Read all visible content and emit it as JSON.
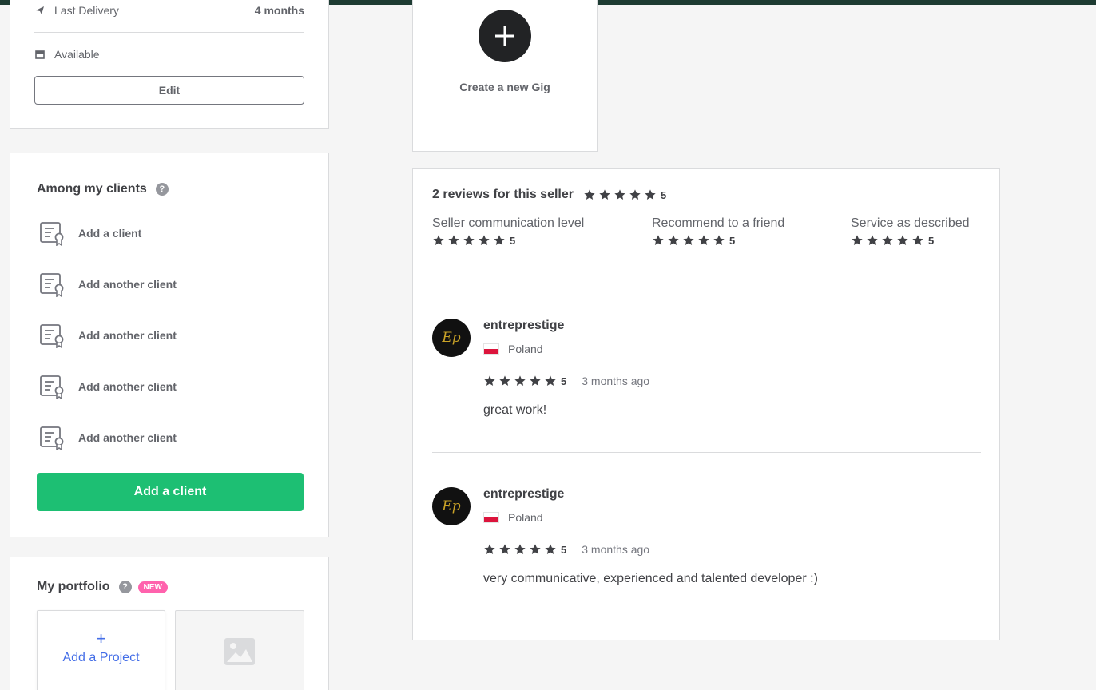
{
  "overview": {
    "last_delivery_label": "Last Delivery",
    "last_delivery_value": "4 months",
    "availability": "Available",
    "edit_label": "Edit"
  },
  "clients": {
    "title": "Among my clients",
    "items": [
      {
        "label": "Add a client"
      },
      {
        "label": "Add another client"
      },
      {
        "label": "Add another client"
      },
      {
        "label": "Add another client"
      },
      {
        "label": "Add another client"
      }
    ],
    "add_button_label": "Add a client"
  },
  "portfolio": {
    "title": "My portfolio",
    "badge": "NEW",
    "add_project_plus": "+",
    "add_project_label": "Add a Project"
  },
  "gig": {
    "create_label": "Create a new Gig"
  },
  "reviews": {
    "header": "2 reviews for this seller",
    "overall_rating": "5",
    "breakdown": [
      {
        "label": "Seller communication level",
        "rating": "5"
      },
      {
        "label": "Recommend to a friend",
        "rating": "5"
      },
      {
        "label": "Service as described",
        "rating": "5"
      }
    ],
    "items": [
      {
        "username": "entreprestige",
        "country": "Poland",
        "rating": "5",
        "date": "3 months ago",
        "text": "great work!",
        "avatar_text": "Ep"
      },
      {
        "username": "entreprestige",
        "country": "Poland",
        "rating": "5",
        "date": "3 months ago",
        "text": "very communicative, experienced and talented developer :)",
        "avatar_text": "Ep"
      }
    ]
  },
  "colors": {
    "accent_green": "#1dbf73",
    "topbar": "#1d3b32",
    "link_blue": "#446ee7",
    "badge_pink": "#ff62ad",
    "star": "#404145"
  }
}
